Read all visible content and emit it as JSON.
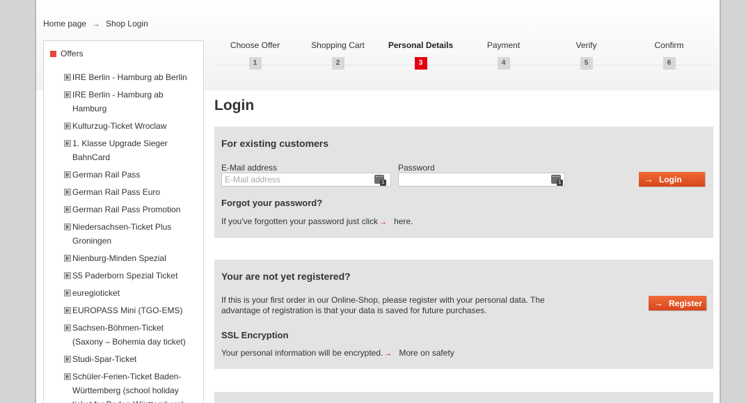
{
  "breadcrumb": {
    "home": "Home page",
    "arrow": "→",
    "current": "Shop Login"
  },
  "sidebar": {
    "heading": "Offers",
    "items": [
      {
        "label": "IRE Berlin - Hamburg ab Berlin"
      },
      {
        "label": "IRE Berlin - Hamburg ab Hamburg"
      },
      {
        "label": "Kulturzug-Ticket Wroclaw"
      },
      {
        "label": "1. Klasse Upgrade Sieger BahnCard"
      },
      {
        "label": "German Rail Pass"
      },
      {
        "label": "German Rail Pass Euro"
      },
      {
        "label": "German Rail Pass Promotion"
      },
      {
        "label": "Niedersachsen-Ticket Plus Groningen"
      },
      {
        "label": "Nienburg-Minden Spezial"
      },
      {
        "label": "S5 Paderborn Spezial Ticket"
      },
      {
        "label": "euregioticket"
      },
      {
        "label": "EUROPASS Mini (TGO-EMS)"
      },
      {
        "label": "Sachsen-Böhmen-Ticket (Saxony – Bohemia day ticket)"
      },
      {
        "label": "Studi-Spar-Ticket"
      },
      {
        "label": "Schüler-Ferien-Ticket Baden-Württemberg (school holiday ticket for Baden-Württemberg)"
      }
    ]
  },
  "steps": [
    {
      "label": "Choose Offer",
      "num": "1"
    },
    {
      "label": "Shopping Cart",
      "num": "2"
    },
    {
      "label": "Personal Details",
      "num": "3",
      "active": true
    },
    {
      "label": "Payment",
      "num": "4"
    },
    {
      "label": "Verify",
      "num": "5"
    },
    {
      "label": "Confirm",
      "num": "6"
    }
  ],
  "login": {
    "title": "Login",
    "existing": {
      "heading": "For existing customers",
      "email_label": "E-Mail address",
      "email_placeholder": "E-Mail address",
      "email_value": "",
      "password_label": "Password",
      "password_value": "",
      "kbd_badge": "1",
      "login_button": "Login",
      "forgot_heading": "Forgot your password?",
      "forgot_text": "If you've forgotten your password just click",
      "forgot_link": "here."
    },
    "register": {
      "heading": "Your are not yet registered?",
      "text_line1": "If this is your first order in our Online-Shop, please register with your personal data. The",
      "text_line2": "advantage of registration is that your data is saved for future purchases.",
      "register_button": "Register",
      "ssl_heading": "SSL Encryption",
      "ssl_text": "Your personal information will be encrypted.",
      "ssl_link": "More on safety"
    }
  },
  "colors": {
    "accent": "#e4000f",
    "button": "#e8552a",
    "panel": "#e3e3e3"
  },
  "icons": {
    "step_arrow": "arrow-right-icon",
    "keyboard": "virtual-keyboard-icon"
  }
}
